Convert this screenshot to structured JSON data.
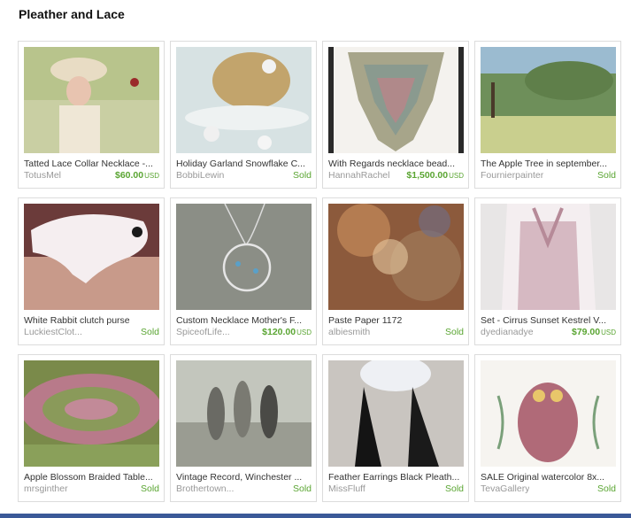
{
  "page": {
    "title": "Pleather and Lace"
  },
  "items": [
    {
      "title": "Tatted Lace Collar Necklace -...",
      "shop": "TotusMel",
      "price": "$60.00",
      "currency": "USD",
      "status": ""
    },
    {
      "title": "Holiday Garland Snowflake C...",
      "shop": "BobbiLewin",
      "price": "",
      "currency": "",
      "status": "Sold"
    },
    {
      "title": "With Regards necklace bead...",
      "shop": "HannahRachel",
      "price": "$1,500.00",
      "currency": "USD",
      "status": ""
    },
    {
      "title": "The Apple Tree in september...",
      "shop": "Fournierpainter",
      "price": "",
      "currency": "",
      "status": "Sold"
    },
    {
      "title": "White Rabbit clutch purse",
      "shop": "LuckiestClot...",
      "price": "",
      "currency": "",
      "status": "Sold"
    },
    {
      "title": "Custom Necklace Mother's F...",
      "shop": "SpiceofLife...",
      "price": "$120.00",
      "currency": "USD",
      "status": ""
    },
    {
      "title": "Paste Paper 1172",
      "shop": "albiesmith",
      "price": "",
      "currency": "",
      "status": "Sold"
    },
    {
      "title": "Set - Cirrus Sunset Kestrel V...",
      "shop": "dyedianadye",
      "price": "$79.00",
      "currency": "USD",
      "status": ""
    },
    {
      "title": "Apple Blossom Braided Table...",
      "shop": "mrsginther",
      "price": "",
      "currency": "",
      "status": "Sold"
    },
    {
      "title": "Vintage Record, Winchester ...",
      "shop": "Brothertown...",
      "price": "",
      "currency": "",
      "status": "Sold"
    },
    {
      "title": "Feather Earrings Black Pleath...",
      "shop": "MissFluff",
      "price": "",
      "currency": "",
      "status": "Sold"
    },
    {
      "title": "SALE Original watercolor 8x...",
      "shop": "TevaGallery",
      "price": "",
      "currency": "",
      "status": "Sold"
    }
  ]
}
